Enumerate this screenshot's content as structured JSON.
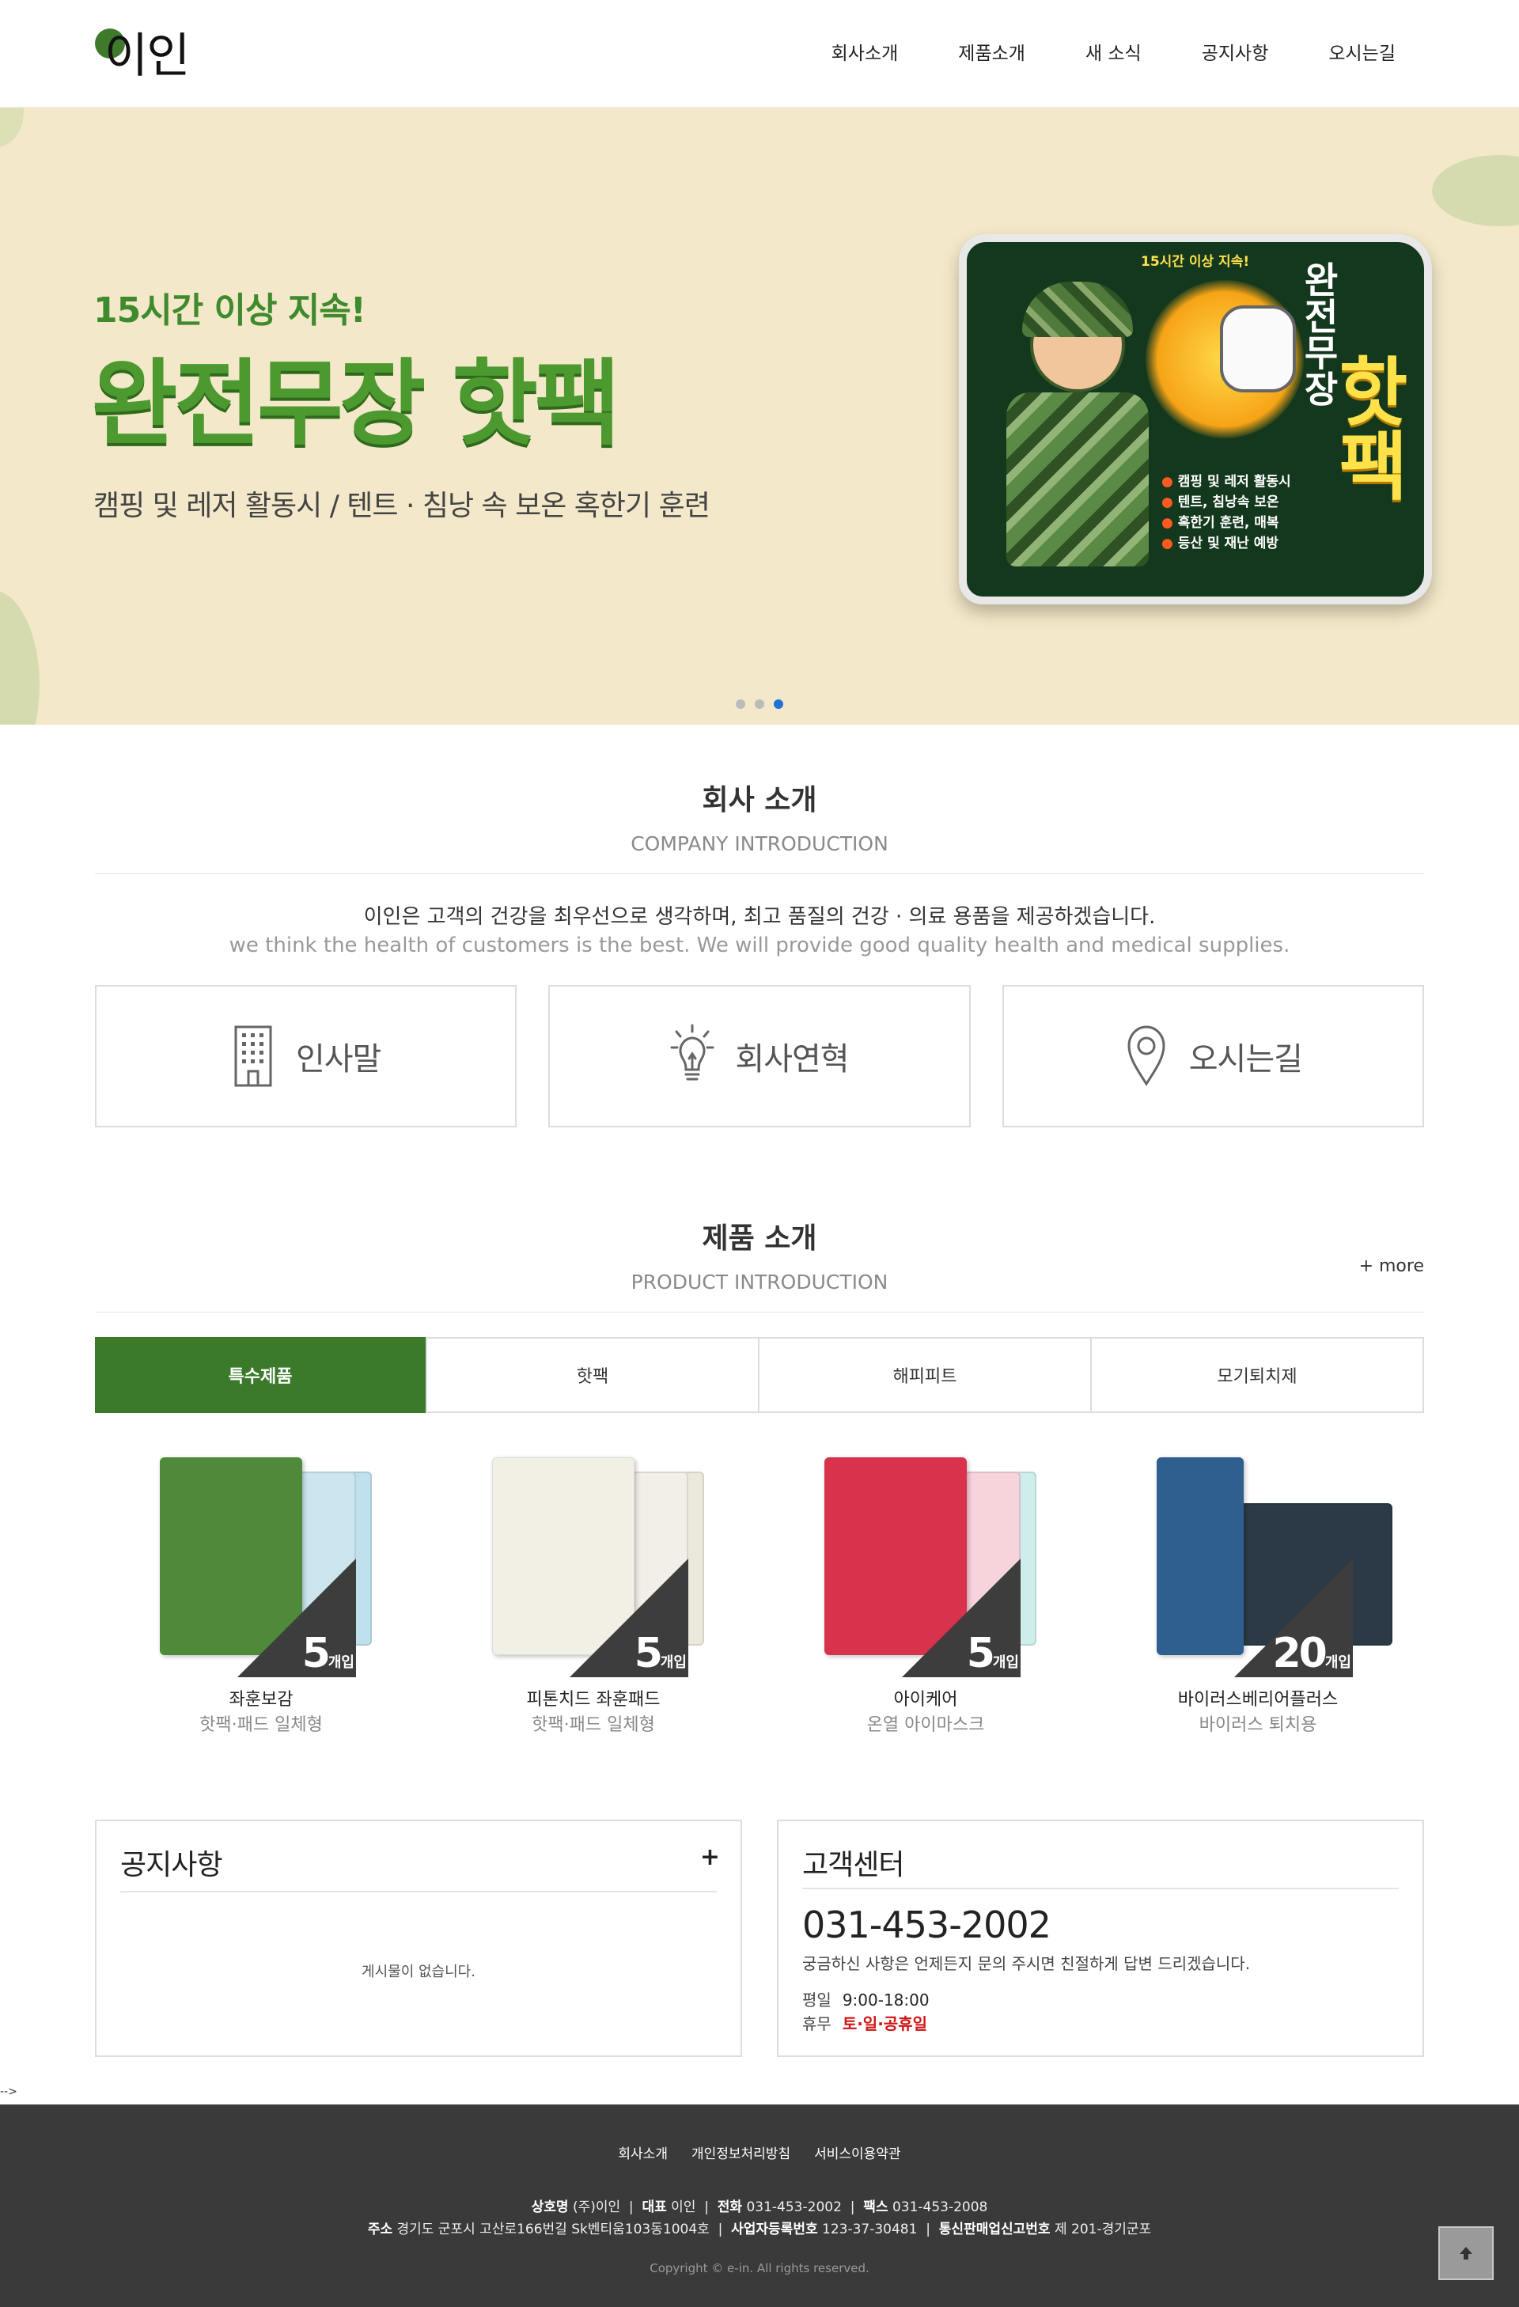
{
  "header": {
    "logo_text": "이인",
    "nav": [
      "회사소개",
      "제품소개",
      "새 소식",
      "공지사항",
      "오시는길"
    ]
  },
  "hero": {
    "subtitle": "15시간 이상 지속!",
    "title": "완전무장 핫팩",
    "description": "캠핑 및 레저 활동시 / 텐트 · 침낭 속 보온 혹한기 훈련",
    "pack": {
      "small_text": "15시간 이상 지속!",
      "vertical_top": "완전무장",
      "vertical_big": "핫팩",
      "features": [
        "캠핑 및 레저 활동시",
        "텐트, 침낭속 보온",
        "혹한기 훈련, 매복",
        "등산 및 재난 예방"
      ]
    },
    "slides_total": 3,
    "active_slide": 3
  },
  "company": {
    "title": "회사 소개",
    "subtitle": "COMPANY INTRODUCTION",
    "desc_ko": "이인은 고객의 건강을 최우선으로 생각하며, 최고 품질의 건강 · 의료 용품을 제공하겠습니다.",
    "desc_en": "we think the health of customers is the best. We will provide good quality health and medical supplies.",
    "boxes": [
      {
        "label": "인사말",
        "icon": "building-icon"
      },
      {
        "label": "회사연혁",
        "icon": "lightbulb-icon"
      },
      {
        "label": "오시는길",
        "icon": "location-pin-icon"
      }
    ]
  },
  "products": {
    "title": "제품 소개",
    "subtitle": "PRODUCT INTRODUCTION",
    "more": "+ more",
    "tabs": [
      "특수제품",
      "핫팩",
      "해피피트",
      "모기퇴치제"
    ],
    "active_tab": 0,
    "items": [
      {
        "name": "좌훈보감",
        "sub": "핫팩·패드 일체형",
        "count": "5",
        "unit": "개입",
        "color": "#4e8a3a"
      },
      {
        "name": "피톤치드 좌훈패드",
        "sub": "핫팩·패드 일체형",
        "count": "5",
        "unit": "개입",
        "color": "#f2efe4"
      },
      {
        "name": "아이케어",
        "sub": "온열 아이마스크",
        "count": "5",
        "unit": "개입",
        "color": "#d8324c"
      },
      {
        "name": "바이러스베리어플러스",
        "sub": "바이러스 퇴치용",
        "count": "20",
        "unit": "개입",
        "color": "#2e5f8f"
      }
    ]
  },
  "notice": {
    "title": "공지사항",
    "plus": "+",
    "empty": "게시물이 없습니다."
  },
  "cs": {
    "title": "고객센터",
    "phone": "031-453-2002",
    "desc": "궁금하신 사항은 언제든지 문의 주시면 친절하게 답변 드리겠습니다.",
    "weekday_label": "평일",
    "weekday_hours": "9:00-18:00",
    "holiday_label": "휴무",
    "holiday_days": "토·일·공휴일"
  },
  "stray_text": "-->",
  "footer": {
    "links": [
      "회사소개",
      "개인정보처리방침",
      "서비스이용약관"
    ],
    "company_label": "상호명",
    "company": "(주)이인",
    "ceo_label": "대표",
    "ceo": "이인",
    "tel_label": "전화",
    "tel": "031-453-2002",
    "fax_label": "팩스",
    "fax": "031-453-2008",
    "address_label": "주소",
    "address": "경기도 군포시 고산로166번길 Sk벤티움103동1004호",
    "bizno_label": "사업자등록번호",
    "bizno": "123-37-30481",
    "ecom_label": "통신판매업신고번호",
    "ecom": "제 201-경기군포",
    "copyright": "Copyright © e-in. All rights reserved."
  },
  "top_button_icon": "arrow-up-icon"
}
